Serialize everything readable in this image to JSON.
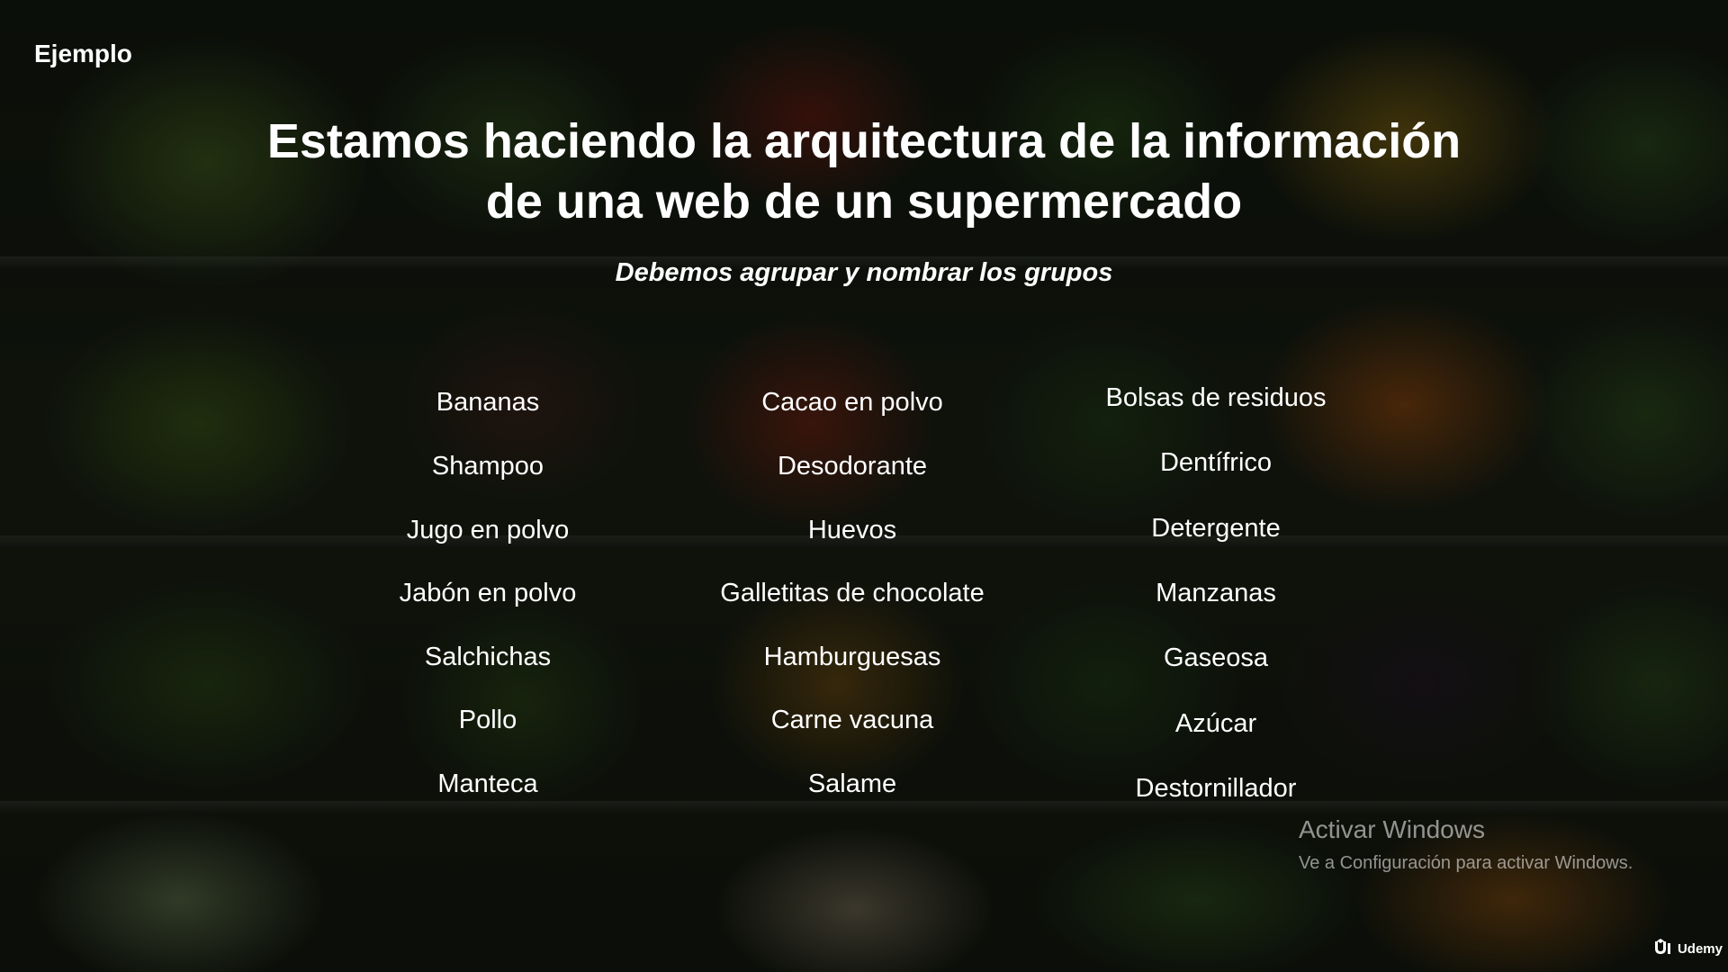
{
  "slide": {
    "corner_label": "Ejemplo",
    "title_line1": "Estamos haciendo la arquitectura de la información",
    "title_line2": "de una web de un supermercado",
    "subtitle": "Debemos agrupar y nombrar los grupos"
  },
  "columns": [
    {
      "items": [
        "Bananas",
        "Shampoo",
        "Jugo en polvo",
        "Jabón en polvo",
        "Salchichas",
        "Pollo",
        "Manteca"
      ]
    },
    {
      "items": [
        "Cacao en polvo",
        "Desodorante",
        "Huevos",
        "Galletitas de chocolate",
        "Hamburguesas",
        "Carne vacuna",
        "Salame"
      ]
    },
    {
      "items": [
        "Bolsas de residuos",
        "Dentífrico",
        "Detergente",
        "Manzanas",
        "Gaseosa",
        "Azúcar",
        "Destornillador"
      ]
    }
  ],
  "watermark": {
    "title": "Activar Windows",
    "subtitle": "Ve a Configuración para activar Windows."
  },
  "brand": {
    "name": "Udemy",
    "icon": "udemy-logo-icon"
  }
}
